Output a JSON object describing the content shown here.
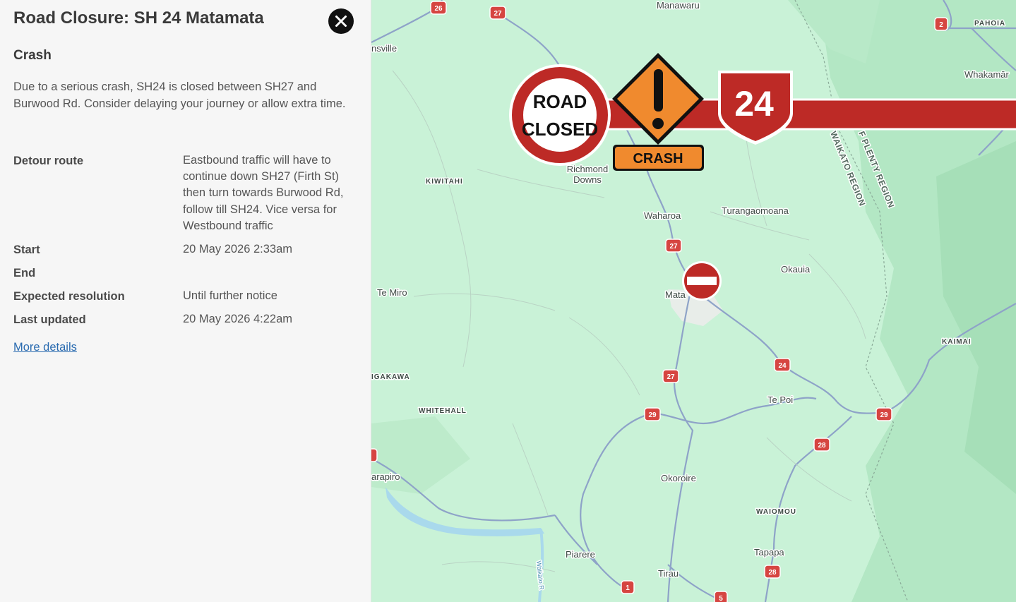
{
  "panel": {
    "title": "Road Closure: SH 24 Matamata",
    "category": "Crash",
    "description": "Due to a serious crash, SH24 is closed between SH27 and Burwood Rd. Consider delaying your journey or allow extra time.",
    "details": [
      {
        "label": "Detour route",
        "value": "Eastbound traffic will have to continue down SH27 (Firth St) then turn towards Burwood Rd, follow till SH24. Vice versa for Westbound traffic"
      },
      {
        "label": "Start",
        "value": "20 May 2026 2:33am"
      },
      {
        "label": "End",
        "value": ""
      },
      {
        "label": "Expected resolution",
        "value": "Until further notice"
      },
      {
        "label": "Last updated",
        "value": "20 May 2026 4:22am"
      }
    ],
    "more_details_link": "More details"
  },
  "map": {
    "road_closed_sign": [
      "ROAD",
      "CLOSED"
    ],
    "crash_sign_label": "CRASH",
    "highway_shield": "24",
    "places": {
      "manawaru": "Manawaru",
      "morrinsville": "nsville",
      "pahoia": "PAHOIA",
      "whakamarama": "Whakamār",
      "kiwitahi": "KIWITAHI",
      "richmond_downs_1": "Richmond",
      "richmond_downs_2": "Downs",
      "waharoa": "Waharoa",
      "turangaomoana": "Turangaomoana",
      "okauia": "Okauia",
      "te_miro": "Te Miro",
      "matamata": "Mata",
      "kaimai": "KAIMAI",
      "hinuera": "IGAKAWA",
      "whitehall": "WHITEHALL",
      "te_poi": "Te Poi",
      "karapiro": "arapiro",
      "okoroire": "Okoroire",
      "waiomou": "WAIOMOU",
      "tapapa": "Tapapa",
      "piarere": "Piarere",
      "tirau": "Tirau",
      "waikato_region": "WAIKATO REGION",
      "bop_region": "F PLENTY REGION",
      "waikato_river": "Waikato R"
    },
    "route_markers": {
      "r26": "26",
      "r27a": "27",
      "r2": "2",
      "r27b": "27",
      "r24": "24",
      "r27c": "27",
      "r29a": "29",
      "r29b": "29",
      "r28a": "28",
      "r28b": "28",
      "r1": "1",
      "r5": "5"
    }
  }
}
